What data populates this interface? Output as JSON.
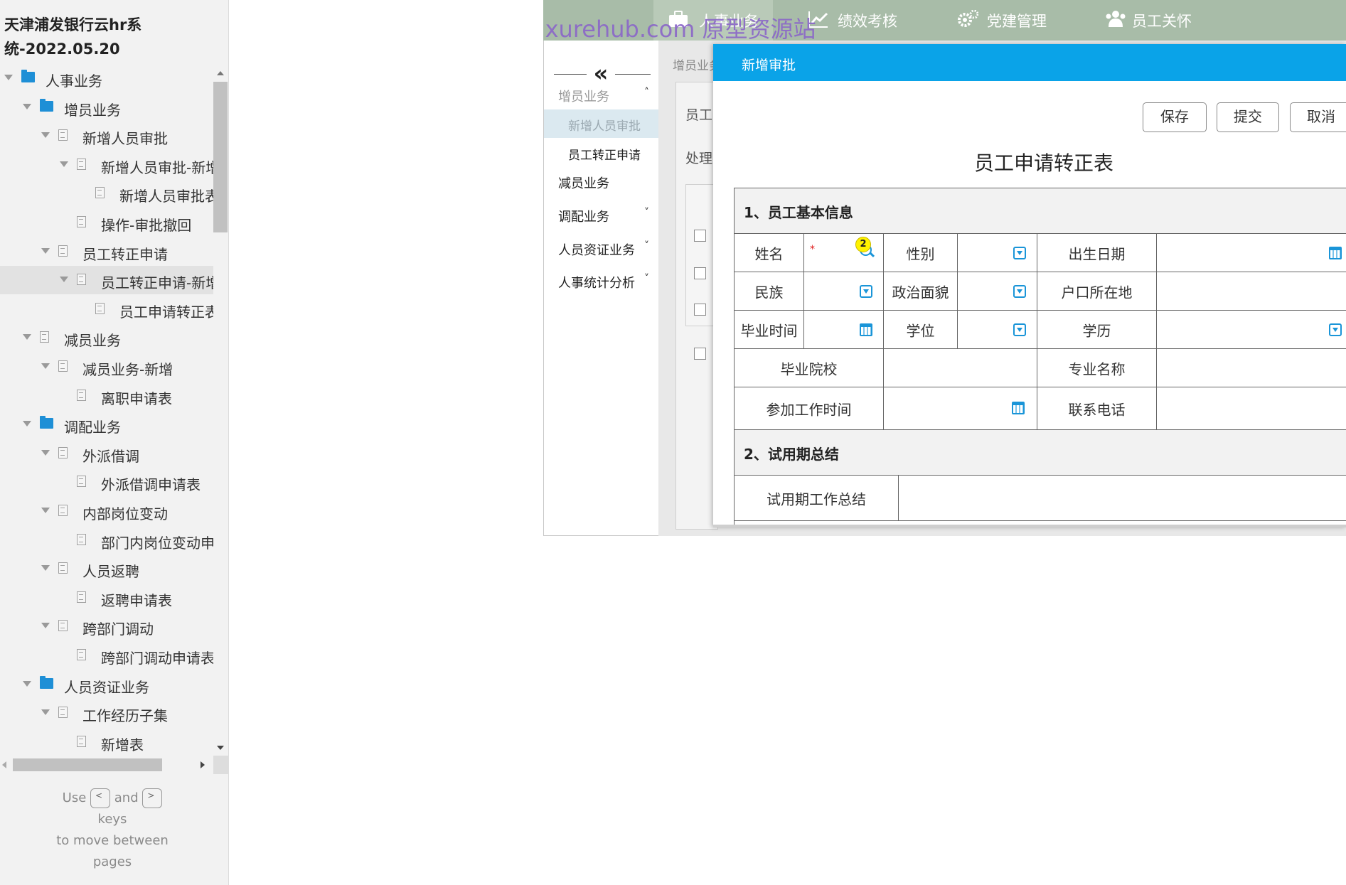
{
  "sitemap": {
    "title_line1": "天津浦发银行云hr系",
    "title_line2": "统-2022.05.20",
    "tree": [
      {
        "label": "人事业务",
        "level": 0,
        "icon": "folder-icon",
        "expanded": true
      },
      {
        "label": "增员业务",
        "level": 1,
        "icon": "folder-icon",
        "expanded": true
      },
      {
        "label": "新增人员审批",
        "level": 2,
        "icon": "page-icon",
        "expanded": true
      },
      {
        "label": "新增人员审批-新增",
        "level": 3,
        "icon": "page-icon",
        "expanded": true
      },
      {
        "label": "新增人员审批表",
        "level": 4,
        "icon": "page-icon",
        "expanded": false
      },
      {
        "label": "操作-审批撤回",
        "level": 3,
        "icon": "page-icon",
        "expanded": false
      },
      {
        "label": "员工转正申请",
        "level": 2,
        "icon": "page-icon",
        "expanded": true
      },
      {
        "label": "员工转正申请-新增",
        "level": 3,
        "icon": "page-icon",
        "expanded": true,
        "selected": true
      },
      {
        "label": "员工申请转正表",
        "level": 4,
        "icon": "page-icon",
        "expanded": false
      },
      {
        "label": "减员业务",
        "level": 1,
        "icon": "page-icon",
        "expanded": true
      },
      {
        "label": "减员业务-新增",
        "level": 2,
        "icon": "page-icon",
        "expanded": true
      },
      {
        "label": "离职申请表",
        "level": 3,
        "icon": "page-icon",
        "expanded": false
      },
      {
        "label": "调配业务",
        "level": 1,
        "icon": "folder-icon",
        "expanded": true
      },
      {
        "label": "外派借调",
        "level": 2,
        "icon": "page-icon",
        "expanded": true
      },
      {
        "label": "外派借调申请表",
        "level": 3,
        "icon": "page-icon",
        "expanded": false
      },
      {
        "label": "内部岗位变动",
        "level": 2,
        "icon": "page-icon",
        "expanded": true
      },
      {
        "label": "部门内岗位变动申请表",
        "level": 3,
        "icon": "page-icon",
        "expanded": false
      },
      {
        "label": "人员返聘",
        "level": 2,
        "icon": "page-icon",
        "expanded": true
      },
      {
        "label": "返聘申请表",
        "level": 3,
        "icon": "page-icon",
        "expanded": false
      },
      {
        "label": "跨部门调动",
        "level": 2,
        "icon": "page-icon",
        "expanded": true
      },
      {
        "label": "跨部门调动申请表",
        "level": 3,
        "icon": "page-icon",
        "expanded": false
      },
      {
        "label": "人员资证业务",
        "level": 1,
        "icon": "folder-icon",
        "expanded": true
      },
      {
        "label": "工作经历子集",
        "level": 2,
        "icon": "page-icon",
        "expanded": true
      },
      {
        "label": "新增表",
        "level": 3,
        "icon": "page-icon",
        "expanded": false
      }
    ],
    "hint": {
      "use": "Use",
      "left_key": "<",
      "and": "and",
      "right_key": ">",
      "keys": "keys",
      "line3": "to move between",
      "line4": "pages"
    }
  },
  "prototype": {
    "watermark": "axurehub.com 原型资源站",
    "topnav": [
      {
        "label": "人事业务",
        "icon": "briefcase-icon"
      },
      {
        "label": "绩效考核",
        "icon": "trend-chart-icon"
      },
      {
        "label": "党建管理",
        "icon": "gears-icon"
      },
      {
        "label": "员工关怀",
        "icon": "people-icon"
      }
    ],
    "collapse_icon": "«",
    "menu": [
      {
        "label": "增员业务",
        "chevron": "˄",
        "muted": true
      },
      {
        "label": "新增人员审批",
        "chevron": "",
        "active": true,
        "sub": true
      },
      {
        "label": "员工转正申请",
        "chevron": "",
        "sub": true
      },
      {
        "label": "减员业务",
        "chevron": ""
      },
      {
        "label": "调配业务",
        "chevron": "˅"
      },
      {
        "label": "人员资证业务",
        "chevron": "˅"
      },
      {
        "label": "人事统计分析",
        "chevron": "˅"
      }
    ],
    "breadcrumb": "增员业务",
    "card_label_1": "员工",
    "card_label_2": "处理"
  },
  "dialog": {
    "title": "新增审批",
    "buttons": {
      "save": "保存",
      "submit": "提交",
      "cancel": "取消"
    },
    "form_title": "员工申请转正表",
    "section1": "1、员工基本信息",
    "section2": "2、试用期总结",
    "fields": {
      "name": "姓名",
      "gender": "性别",
      "birth_date": "出生日期",
      "ethnicity": "民族",
      "political_status": "政治面貌",
      "hukou": "户口所在地",
      "grad_time": "毕业时间",
      "degree": "学位",
      "education": "学历",
      "school": "毕业院校",
      "major": "专业名称",
      "work_start": "参加工作时间",
      "phone": "联系电话",
      "probation_summary": "试用期工作总结"
    },
    "required_mark": "*",
    "badge": "2"
  }
}
